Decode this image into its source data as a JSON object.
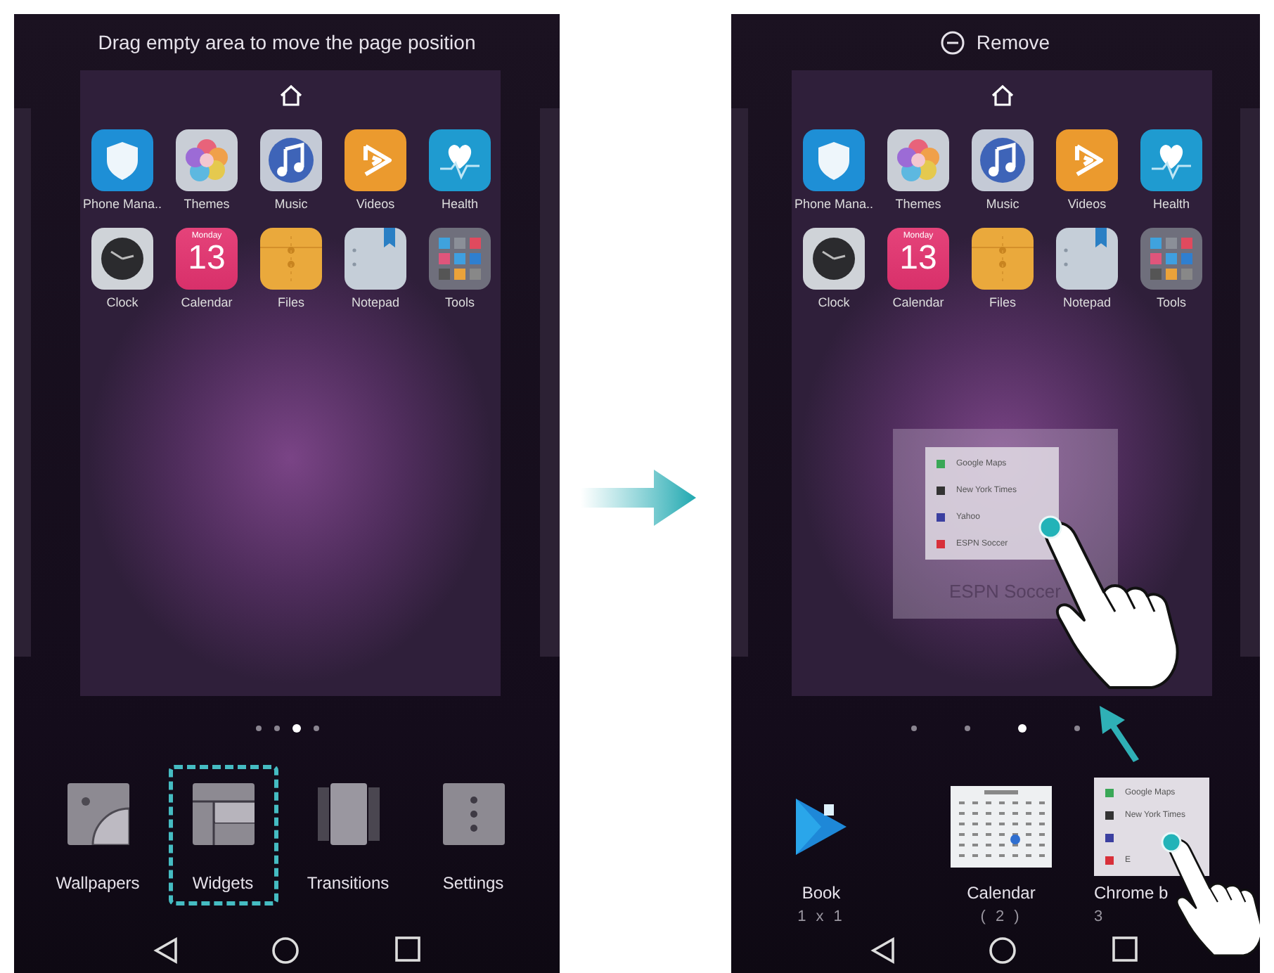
{
  "left_screen": {
    "header": {
      "kind": "hint",
      "text": "Drag empty area to move the page position"
    },
    "apps": [
      {
        "kind": "shield",
        "label": "Phone Mana.."
      },
      {
        "kind": "themes",
        "label": "Themes"
      },
      {
        "kind": "music",
        "label": "Music"
      },
      {
        "kind": "videos",
        "label": "Videos"
      },
      {
        "kind": "health",
        "label": "Health"
      },
      {
        "kind": "clock",
        "label": "Clock"
      },
      {
        "kind": "calendar",
        "label": "Calendar",
        "day": "Monday",
        "date": "13"
      },
      {
        "kind": "files",
        "label": "Files"
      },
      {
        "kind": "notepad",
        "label": "Notepad"
      },
      {
        "kind": "tools",
        "label": "Tools"
      }
    ],
    "page_dots": [
      {
        "selected": false
      },
      {
        "selected": false
      },
      {
        "selected": true
      },
      {
        "selected": false
      }
    ],
    "edit_options": [
      {
        "kind": "wallpapers",
        "label": "Wallpapers",
        "highlighted": false
      },
      {
        "kind": "widgets",
        "label": "Widgets",
        "highlighted": true
      },
      {
        "kind": "transitions",
        "label": "Transitions",
        "highlighted": false
      },
      {
        "kind": "settings",
        "label": "Settings",
        "highlighted": false
      }
    ]
  },
  "right_screen": {
    "header": {
      "kind": "remove",
      "text": "Remove"
    },
    "apps": [
      {
        "kind": "shield",
        "label": "Phone Mana.."
      },
      {
        "kind": "themes",
        "label": "Themes"
      },
      {
        "kind": "music",
        "label": "Music"
      },
      {
        "kind": "videos",
        "label": "Videos"
      },
      {
        "kind": "health",
        "label": "Health"
      },
      {
        "kind": "clock",
        "label": "Clock"
      },
      {
        "kind": "calendar",
        "label": "Calendar",
        "day": "Monday",
        "date": "13"
      },
      {
        "kind": "files",
        "label": "Files"
      },
      {
        "kind": "notepad",
        "label": "Notepad"
      },
      {
        "kind": "tools",
        "label": "Tools"
      }
    ],
    "dragged_widget": {
      "ghost_label": "ESPN Soccer",
      "items": [
        {
          "label": "Google Maps",
          "color": "#3aa757"
        },
        {
          "label": "New York Times",
          "color": "#333333"
        },
        {
          "label": "Yahoo",
          "color": "#3b3fa0"
        },
        {
          "label": "ESPN Soccer",
          "color": "#d8303a"
        }
      ]
    },
    "page_dots": [
      {
        "selected": false
      },
      {
        "selected": false
      },
      {
        "selected": true
      },
      {
        "selected": false
      }
    ],
    "widgets": [
      {
        "kind": "book",
        "title": "Book",
        "size": "1 x 1"
      },
      {
        "kind": "calendar",
        "title": "Calendar",
        "size": "( 2 )"
      },
      {
        "kind": "list",
        "title": "Chrome b",
        "size": "3",
        "items": [
          {
            "label": "Google Maps",
            "color": "#3aa757"
          },
          {
            "label": "New York Times",
            "color": "#333333"
          },
          {
            "color": "#3b3fa0"
          },
          {
            "label": "E",
            "color": "#d8303a"
          }
        ]
      }
    ]
  }
}
